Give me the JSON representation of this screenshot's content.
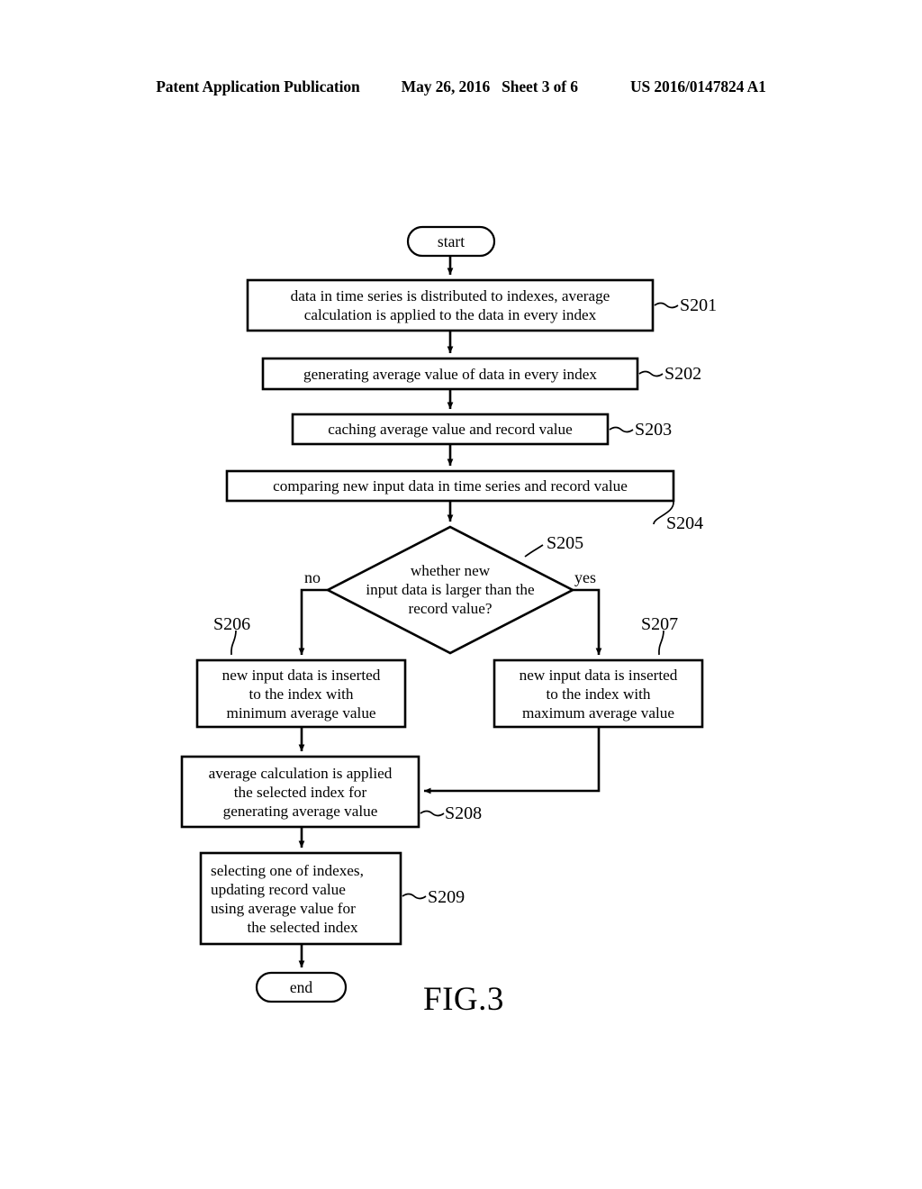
{
  "header": {
    "publication": "Patent Application Publication",
    "date": "May 26, 2016",
    "sheet": "Sheet 3 of 6",
    "patent_number": "US 2016/0147824 A1"
  },
  "figure": {
    "caption": "FIG.3"
  },
  "flowchart": {
    "start": {
      "label": "start"
    },
    "end": {
      "label": "end"
    },
    "branches": {
      "no": "no",
      "yes": "yes"
    },
    "steps": [
      {
        "id": "S201",
        "tag": "S201",
        "lines": [
          "data in time series is distributed to indexes, average",
          "calculation is applied to the data in every index"
        ]
      },
      {
        "id": "S202",
        "tag": "S202",
        "lines": [
          "generating average value of data in every index"
        ]
      },
      {
        "id": "S203",
        "tag": "S203",
        "lines": [
          "caching average value and record value"
        ]
      },
      {
        "id": "S204",
        "tag": "S204",
        "lines": [
          "comparing new input data in time series and record value"
        ]
      },
      {
        "id": "S205",
        "tag": "S205",
        "lines": [
          "whether new",
          "input data is larger than the",
          "record value?"
        ]
      },
      {
        "id": "S206",
        "tag": "S206",
        "lines": [
          "new input data is inserted",
          "to the index with",
          "minimum average value"
        ]
      },
      {
        "id": "S207",
        "tag": "S207",
        "lines": [
          "new input data is inserted",
          "to the index with",
          "maximum average value"
        ]
      },
      {
        "id": "S208",
        "tag": "S208",
        "lines": [
          "average calculation is applied",
          "the selected index for",
          "generating average value"
        ]
      },
      {
        "id": "S209",
        "tag": "S209",
        "lines": [
          "selecting one of indexes,",
          "updating record value",
          "using average value for",
          "the selected index"
        ]
      }
    ]
  },
  "colors": {
    "ink": "#000000",
    "paper": "#ffffff"
  }
}
